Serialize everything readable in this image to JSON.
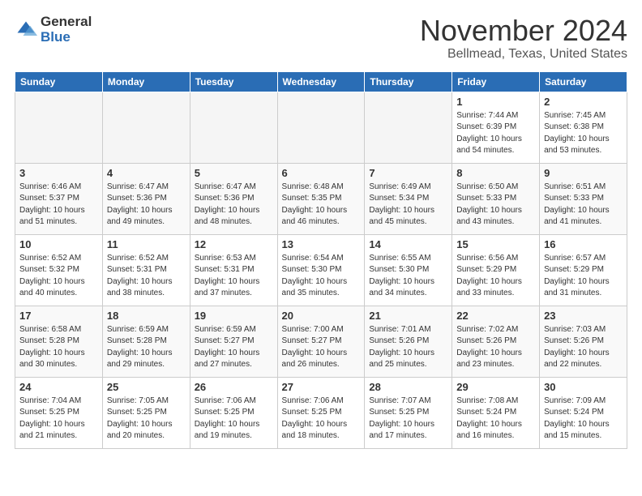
{
  "header": {
    "logo_general": "General",
    "logo_blue": "Blue",
    "month_title": "November 2024",
    "location": "Bellmead, Texas, United States"
  },
  "weekdays": [
    "Sunday",
    "Monday",
    "Tuesday",
    "Wednesday",
    "Thursday",
    "Friday",
    "Saturday"
  ],
  "weeks": [
    [
      {
        "day": "",
        "info": ""
      },
      {
        "day": "",
        "info": ""
      },
      {
        "day": "",
        "info": ""
      },
      {
        "day": "",
        "info": ""
      },
      {
        "day": "",
        "info": ""
      },
      {
        "day": "1",
        "info": "Sunrise: 7:44 AM\nSunset: 6:39 PM\nDaylight: 10 hours and 54 minutes."
      },
      {
        "day": "2",
        "info": "Sunrise: 7:45 AM\nSunset: 6:38 PM\nDaylight: 10 hours and 53 minutes."
      }
    ],
    [
      {
        "day": "3",
        "info": "Sunrise: 6:46 AM\nSunset: 5:37 PM\nDaylight: 10 hours and 51 minutes."
      },
      {
        "day": "4",
        "info": "Sunrise: 6:47 AM\nSunset: 5:36 PM\nDaylight: 10 hours and 49 minutes."
      },
      {
        "day": "5",
        "info": "Sunrise: 6:47 AM\nSunset: 5:36 PM\nDaylight: 10 hours and 48 minutes."
      },
      {
        "day": "6",
        "info": "Sunrise: 6:48 AM\nSunset: 5:35 PM\nDaylight: 10 hours and 46 minutes."
      },
      {
        "day": "7",
        "info": "Sunrise: 6:49 AM\nSunset: 5:34 PM\nDaylight: 10 hours and 45 minutes."
      },
      {
        "day": "8",
        "info": "Sunrise: 6:50 AM\nSunset: 5:33 PM\nDaylight: 10 hours and 43 minutes."
      },
      {
        "day": "9",
        "info": "Sunrise: 6:51 AM\nSunset: 5:33 PM\nDaylight: 10 hours and 41 minutes."
      }
    ],
    [
      {
        "day": "10",
        "info": "Sunrise: 6:52 AM\nSunset: 5:32 PM\nDaylight: 10 hours and 40 minutes."
      },
      {
        "day": "11",
        "info": "Sunrise: 6:52 AM\nSunset: 5:31 PM\nDaylight: 10 hours and 38 minutes."
      },
      {
        "day": "12",
        "info": "Sunrise: 6:53 AM\nSunset: 5:31 PM\nDaylight: 10 hours and 37 minutes."
      },
      {
        "day": "13",
        "info": "Sunrise: 6:54 AM\nSunset: 5:30 PM\nDaylight: 10 hours and 35 minutes."
      },
      {
        "day": "14",
        "info": "Sunrise: 6:55 AM\nSunset: 5:30 PM\nDaylight: 10 hours and 34 minutes."
      },
      {
        "day": "15",
        "info": "Sunrise: 6:56 AM\nSunset: 5:29 PM\nDaylight: 10 hours and 33 minutes."
      },
      {
        "day": "16",
        "info": "Sunrise: 6:57 AM\nSunset: 5:29 PM\nDaylight: 10 hours and 31 minutes."
      }
    ],
    [
      {
        "day": "17",
        "info": "Sunrise: 6:58 AM\nSunset: 5:28 PM\nDaylight: 10 hours and 30 minutes."
      },
      {
        "day": "18",
        "info": "Sunrise: 6:59 AM\nSunset: 5:28 PM\nDaylight: 10 hours and 29 minutes."
      },
      {
        "day": "19",
        "info": "Sunrise: 6:59 AM\nSunset: 5:27 PM\nDaylight: 10 hours and 27 minutes."
      },
      {
        "day": "20",
        "info": "Sunrise: 7:00 AM\nSunset: 5:27 PM\nDaylight: 10 hours and 26 minutes."
      },
      {
        "day": "21",
        "info": "Sunrise: 7:01 AM\nSunset: 5:26 PM\nDaylight: 10 hours and 25 minutes."
      },
      {
        "day": "22",
        "info": "Sunrise: 7:02 AM\nSunset: 5:26 PM\nDaylight: 10 hours and 23 minutes."
      },
      {
        "day": "23",
        "info": "Sunrise: 7:03 AM\nSunset: 5:26 PM\nDaylight: 10 hours and 22 minutes."
      }
    ],
    [
      {
        "day": "24",
        "info": "Sunrise: 7:04 AM\nSunset: 5:25 PM\nDaylight: 10 hours and 21 minutes."
      },
      {
        "day": "25",
        "info": "Sunrise: 7:05 AM\nSunset: 5:25 PM\nDaylight: 10 hours and 20 minutes."
      },
      {
        "day": "26",
        "info": "Sunrise: 7:06 AM\nSunset: 5:25 PM\nDaylight: 10 hours and 19 minutes."
      },
      {
        "day": "27",
        "info": "Sunrise: 7:06 AM\nSunset: 5:25 PM\nDaylight: 10 hours and 18 minutes."
      },
      {
        "day": "28",
        "info": "Sunrise: 7:07 AM\nSunset: 5:25 PM\nDaylight: 10 hours and 17 minutes."
      },
      {
        "day": "29",
        "info": "Sunrise: 7:08 AM\nSunset: 5:24 PM\nDaylight: 10 hours and 16 minutes."
      },
      {
        "day": "30",
        "info": "Sunrise: 7:09 AM\nSunset: 5:24 PM\nDaylight: 10 hours and 15 minutes."
      }
    ]
  ]
}
